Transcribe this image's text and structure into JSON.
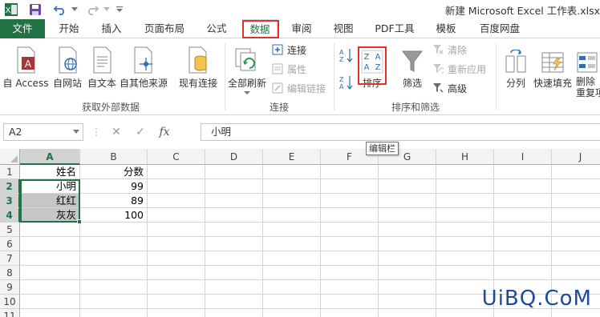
{
  "window": {
    "title": "新建 Microsoft Excel 工作表.xlsx"
  },
  "quick_access": [
    {
      "name": "excel-logo-icon"
    },
    {
      "name": "save-icon"
    },
    {
      "name": "undo-icon"
    },
    {
      "name": "redo-icon"
    }
  ],
  "tabs": [
    {
      "label": "文件"
    },
    {
      "label": "开始"
    },
    {
      "label": "插入"
    },
    {
      "label": "页面布局"
    },
    {
      "label": "公式"
    },
    {
      "label": "数据"
    },
    {
      "label": "审阅"
    },
    {
      "label": "视图"
    },
    {
      "label": "PDF工具"
    },
    {
      "label": "模板"
    },
    {
      "label": "百度网盘"
    }
  ],
  "active_tab": "数据",
  "ribbon": {
    "get_external": {
      "group_label": "获取外部数据",
      "buttons": [
        "自 Access",
        "自网站",
        "自文本",
        "自其他来源",
        "现有连接"
      ]
    },
    "connections": {
      "group_label": "连接",
      "refresh_all": "全部刷新",
      "connections_btn": "连接",
      "properties_btn": "属性",
      "edit_links_btn": "编辑链接"
    },
    "sort_filter": {
      "group_label": "排序和筛选",
      "sort_btn": "排序",
      "filter_btn": "筛选",
      "clear_btn": "清除",
      "reapply_btn": "重新应用",
      "advanced_btn": "高级"
    },
    "data_tools": {
      "text_to_columns": "分列",
      "flash_fill": "快速填充",
      "remove_duplicates_line1": "删除",
      "remove_duplicates_line2": "重复项"
    }
  },
  "formula_bar": {
    "name_box": "A2",
    "formula": "小明",
    "fx_label": "fx",
    "tooltip": "编辑栏"
  },
  "sheet": {
    "columns": [
      "A",
      "B",
      "C",
      "D",
      "E",
      "F",
      "G",
      "H",
      "I",
      "J"
    ],
    "rows": [
      "1",
      "2",
      "3",
      "4",
      "5",
      "6",
      "7",
      "8",
      "9",
      "10",
      "11"
    ],
    "data": [
      [
        "姓名",
        "分数"
      ],
      [
        "小明",
        "99"
      ],
      [
        "红红",
        "89"
      ],
      [
        "灰灰",
        "100"
      ]
    ],
    "active_cell": "A2",
    "selection": "A2:A4"
  },
  "watermark": "UiBQ.CoM",
  "colors": {
    "excel_green": "#217346",
    "highlight_red": "#e0312f",
    "selection_gray": "#c6c6c6"
  }
}
